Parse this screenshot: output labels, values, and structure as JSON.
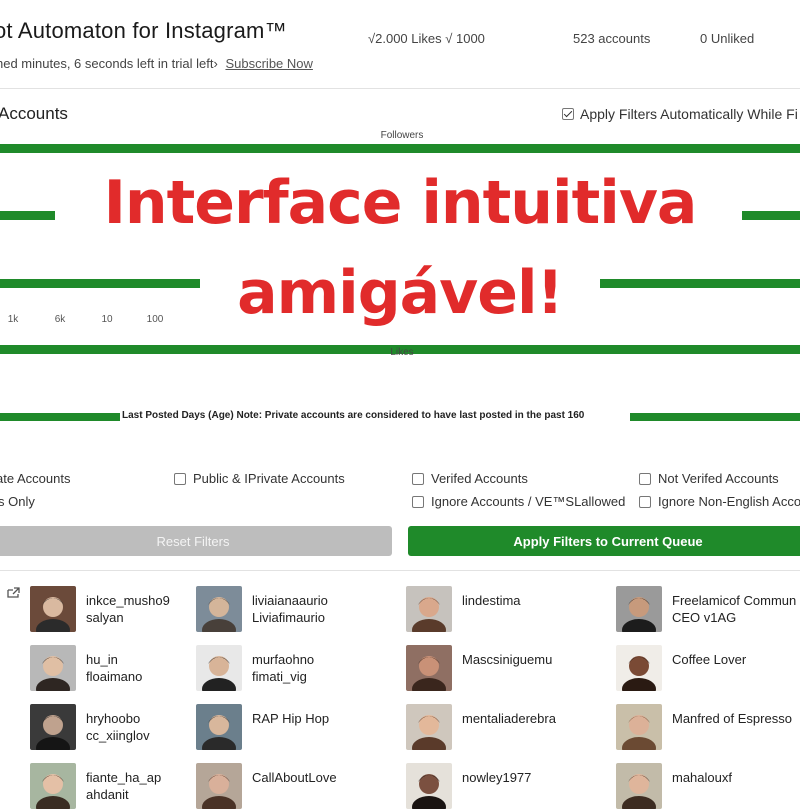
{
  "header": {
    "title": "ot Automaton for Instagram™",
    "trial_text": "hed minutes, 6 seconds left in trial left›",
    "subscribe_link": "Subscribe Now",
    "stats": [
      "√2.000 Likes √ 1000",
      "523 accounts",
      "0 Unliked"
    ]
  },
  "filters": {
    "section_title": "Accounts",
    "auto_apply_label": "Apply Filters Automatically While Fi",
    "auto_apply_checked": true,
    "followers_label": "Followers",
    "likes_label": "Likes",
    "ticks": [
      "1k",
      "6k",
      "10",
      "100"
    ],
    "last_posted_note": "Last Posted Days (Age) Note: Private accounts are considered to have last posted in the past 160",
    "options": [
      {
        "label": "ate Accounts",
        "checked": false
      },
      {
        "label": "Public & IPrivate Accounts",
        "checked": false
      },
      {
        "label": "Verifed Accounts",
        "checked": false
      },
      {
        "label": "Not Verifed Accounts",
        "checked": false
      },
      {
        "label": "s Only",
        "checked": false
      },
      {
        "label": "Ignore Accounts / VE™SLallowed",
        "checked": false
      },
      {
        "label": "Ignore Non-English Acco",
        "checked": false
      }
    ],
    "reset_label": "Reset Filters",
    "apply_label": "Apply Filters to Current Queue"
  },
  "overlay": {
    "line1": "Interface intuitiva",
    "line2": "amigável!",
    "color": "#e12b2b"
  },
  "colors": {
    "accent": "#1f8a2a",
    "overlay": "#e12b2b",
    "reset": "#bdbdbd"
  },
  "accounts": [
    {
      "line1": "inkce_musho9",
      "line2": "salyan"
    },
    {
      "line1": "liviaianaaurio",
      "line2": "Liviafimaurio"
    },
    {
      "line1": "lindestima",
      "line2": ""
    },
    {
      "line1": "Freelamicof Commun",
      "line2": "CEO v1AG"
    },
    {
      "line1": "hu_in",
      "line2": "floaimano"
    },
    {
      "line1": "murfaohno",
      "line2": "fimati_vig"
    },
    {
      "line1": "Mascsiniguemu",
      "line2": ""
    },
    {
      "line1": "Coffee Lover",
      "line2": ""
    },
    {
      "line1": "hryhoobo",
      "line2": "cc_xiinglov"
    },
    {
      "line1": "RAP Hip Hop",
      "line2": ""
    },
    {
      "line1": "mentaliaderebra",
      "line2": ""
    },
    {
      "line1": "Manfred of Espresso",
      "line2": ""
    },
    {
      "line1": "fiante_ha_ap",
      "line2": "ahdanit"
    },
    {
      "line1": "CallAboutLove",
      "line2": ""
    },
    {
      "line1": "nowley1977",
      "line2": ""
    },
    {
      "line1": "mahalouxf",
      "line2": ""
    }
  ]
}
